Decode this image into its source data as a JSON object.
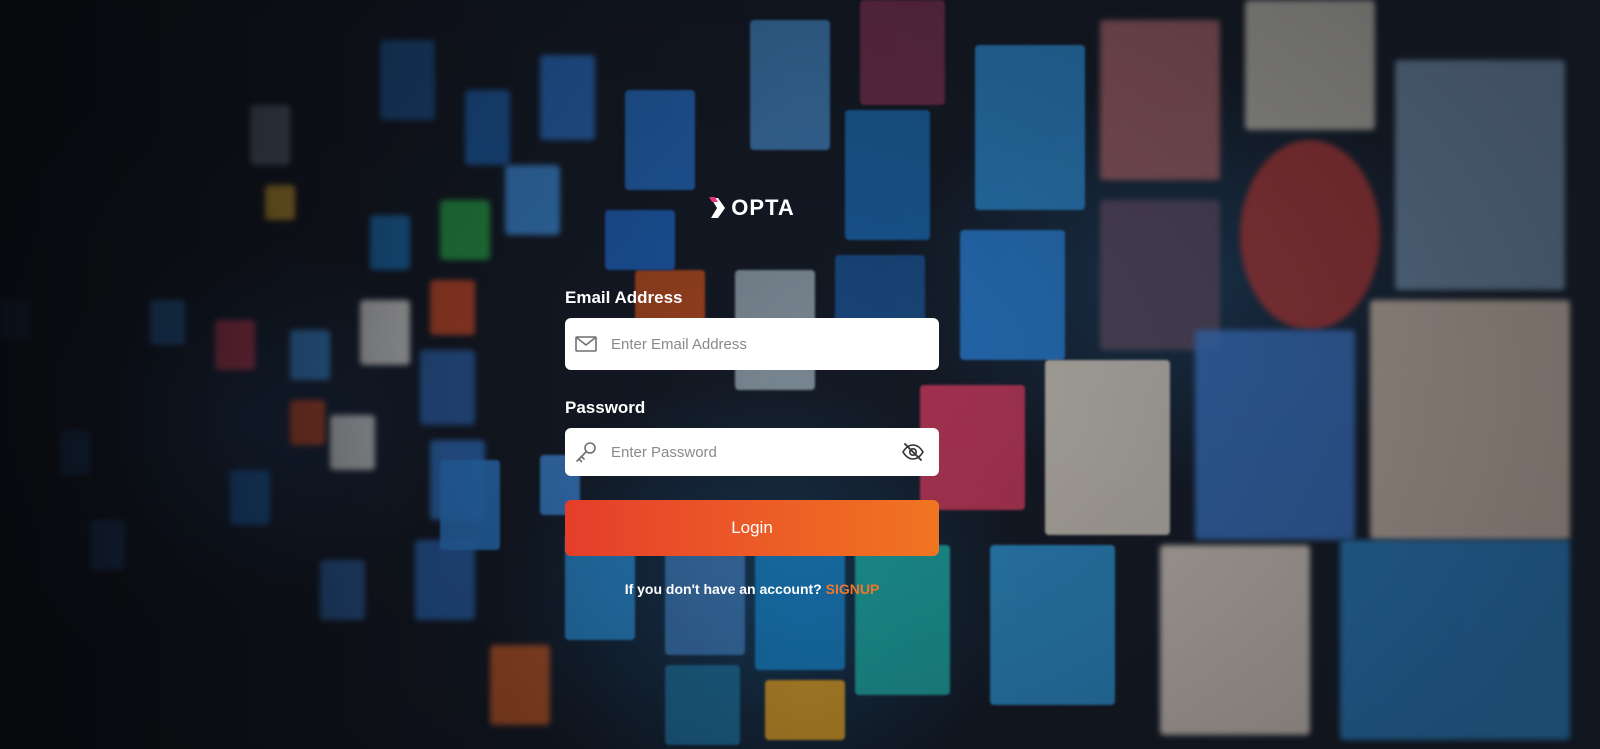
{
  "brand": {
    "logo_text": "OPTA",
    "logo_mark_color": "#e0357a"
  },
  "form": {
    "email": {
      "label": "Email Address",
      "placeholder": "Enter Email Address",
      "icon": "mail-icon"
    },
    "password": {
      "label": "Password",
      "placeholder": "Enter Password",
      "icon": "key-icon",
      "toggle_icon": "eye-off-icon"
    },
    "login_label": "Login",
    "signup_prompt": "If you don't have an account?",
    "signup_link": "SIGNUP"
  },
  "colors": {
    "button_gradient_start": "#e53e2b",
    "button_gradient_end": "#f07521",
    "signup_link": "#f0762a"
  }
}
